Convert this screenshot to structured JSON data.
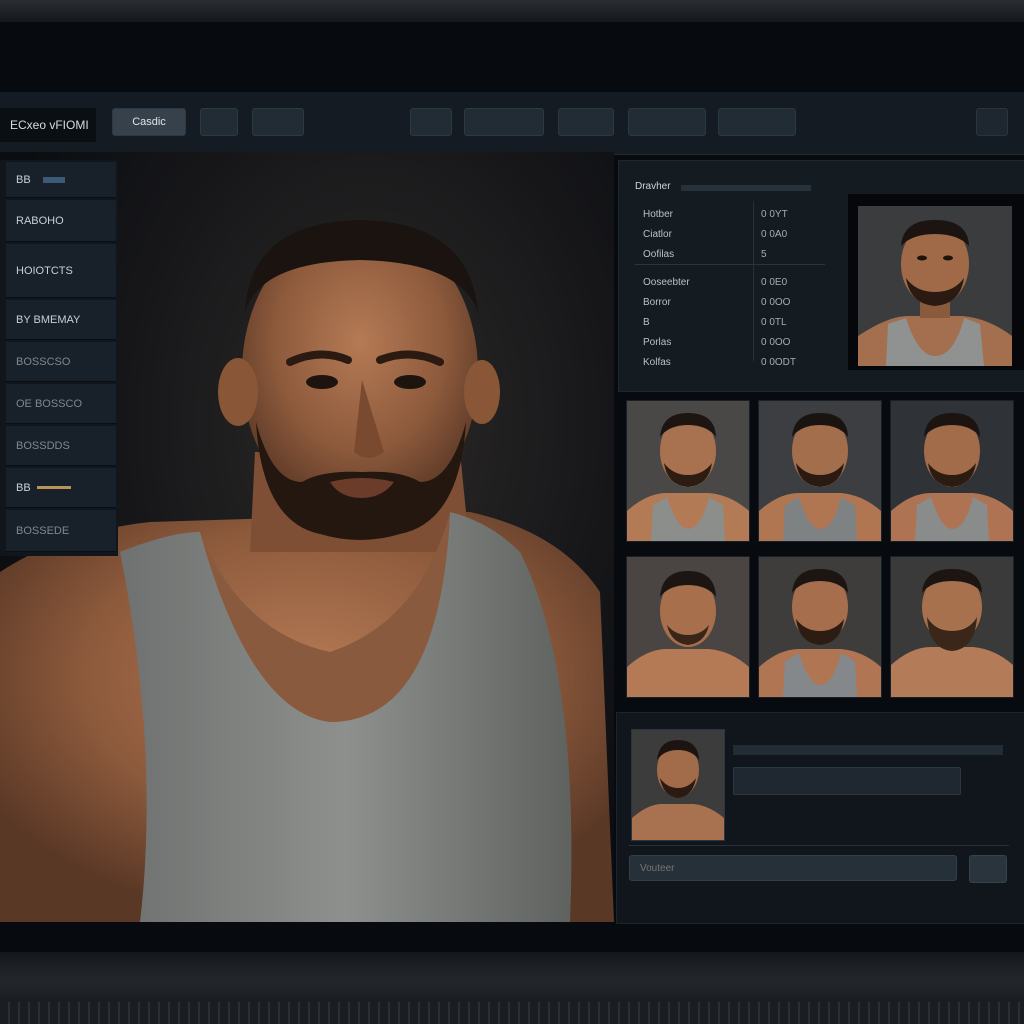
{
  "app": {
    "title": "ECxeo vFIOMI"
  },
  "toolbar": {
    "buttons": [
      {
        "label": "Casdic"
      },
      {
        "label": ""
      },
      {
        "label": ""
      },
      {
        "label": ""
      },
      {
        "label": ""
      },
      {
        "label": ""
      },
      {
        "label": ""
      }
    ]
  },
  "sidebar": {
    "items": [
      {
        "label": "BB"
      },
      {
        "label": "RABOHO"
      },
      {
        "label": "HOIOTCTS"
      },
      {
        "label": "BY BMEMAY"
      },
      {
        "label": "BOSSCSO"
      },
      {
        "label": "OE BOSSCO"
      },
      {
        "label": "BOSSDDS"
      },
      {
        "label": "BB"
      },
      {
        "label": "BOSSEDE"
      }
    ]
  },
  "info_panel": {
    "title": "Dravher",
    "rows": [
      {
        "key": "Hotber",
        "value": "0 0YT"
      },
      {
        "key": "Ciatlor",
        "value": "0 0A0"
      },
      {
        "key": "Oofilas",
        "value": "5"
      },
      {
        "key": "Ooseebter",
        "value": "0 0E0"
      },
      {
        "key": "Borror",
        "value": "0 0OO"
      },
      {
        "key": "B",
        "value": "0 0TL"
      },
      {
        "key": "Porlas",
        "value": "0 0OO"
      },
      {
        "key": "Kolfas",
        "value": "0 0ODT"
      }
    ]
  },
  "bottom_panel": {
    "search_placeholder": "Vouteer"
  },
  "colors": {
    "background": "#070a0e",
    "panel": "#141b21",
    "accent": "#b8945a"
  }
}
